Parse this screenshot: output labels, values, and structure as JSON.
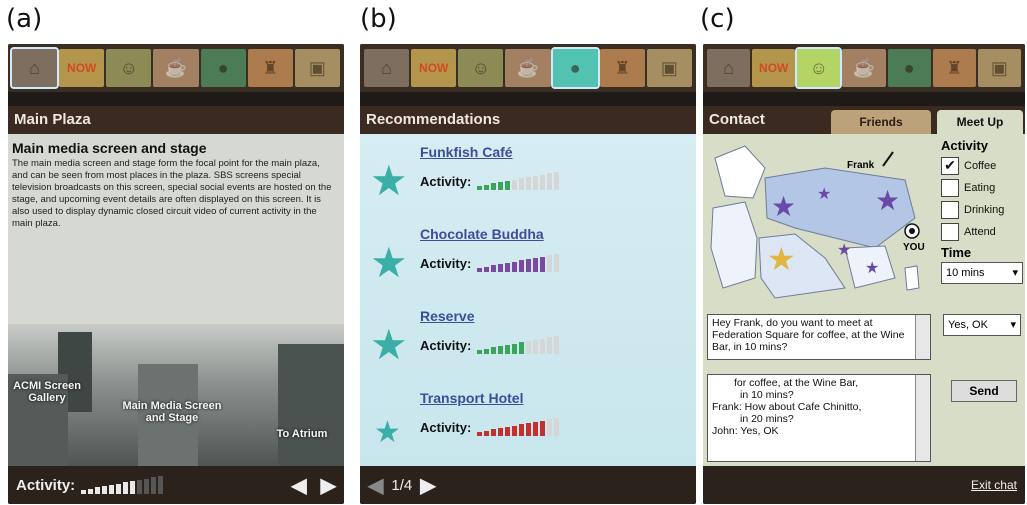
{
  "labels": {
    "a": "(a)",
    "b": "(b)",
    "c": "(c)"
  },
  "icon_bar": [
    "home-icon",
    "now-icon",
    "baby-icon",
    "coffee-icon",
    "plate-icon",
    "drink-icon",
    "id-card-icon"
  ],
  "icon_now_text": "NOW",
  "panel_a": {
    "title": "Main Plaza",
    "heading": "Main media screen and stage",
    "body": "The main media screen and stage form the focal point for the main plaza, and can be seen from most places in the plaza. SBS screens special television broadcasts on this screen, special social events are hosted on the stage, and upcoming event details are often displayed on this screen. It is also used to display dynamic closed circuit video of current activity in the main plaza.",
    "photo_labels": {
      "left": "ACMI Screen Gallery",
      "center": "Main Media Screen and Stage",
      "right": "To Atrium"
    },
    "activity_label": "Activity:",
    "activity_level": 0.7
  },
  "panel_b": {
    "title": "Recommendations",
    "items": [
      {
        "name": "Funkfish Café",
        "activity_label": "Activity:",
        "level": 0.4,
        "color": "#3aa45a"
      },
      {
        "name": "Chocolate Buddha",
        "activity_label": "Activity:",
        "level": 0.8,
        "color": "#7a4aa0"
      },
      {
        "name": "Reserve",
        "activity_label": "Activity:",
        "level": 0.6,
        "color": "#3aa45a"
      },
      {
        "name": "Transport Hotel",
        "activity_label": "Activity:",
        "level": 0.8,
        "color": "#c43030"
      }
    ],
    "pagination": "1/4"
  },
  "panel_c": {
    "title": "Contact",
    "tabs": [
      "Friends",
      "Meet Up"
    ],
    "map_labels": {
      "frank": "Frank",
      "you": "YOU"
    },
    "activity_heading": "Activity",
    "activities": [
      {
        "label": "Coffee",
        "checked": true
      },
      {
        "label": "Eating",
        "checked": false
      },
      {
        "label": "Drinking",
        "checked": false
      },
      {
        "label": "Attend",
        "checked": false
      }
    ],
    "time_heading": "Time",
    "time_value": "10 mins",
    "reply_value": "Yes, OK",
    "draft_message": "Hey Frank, do you want to meet at Federation Square for coffee, at the Wine Bar, in 10 mins?",
    "chat_log": [
      "for coffee, at the Wine Bar,",
      "in 10 mins?",
      "Frank: How about Cafe Chinitto,",
      "in 20 mins?",
      "John: Yes, OK"
    ],
    "send_label": "Send",
    "exit_label": "Exit chat"
  }
}
